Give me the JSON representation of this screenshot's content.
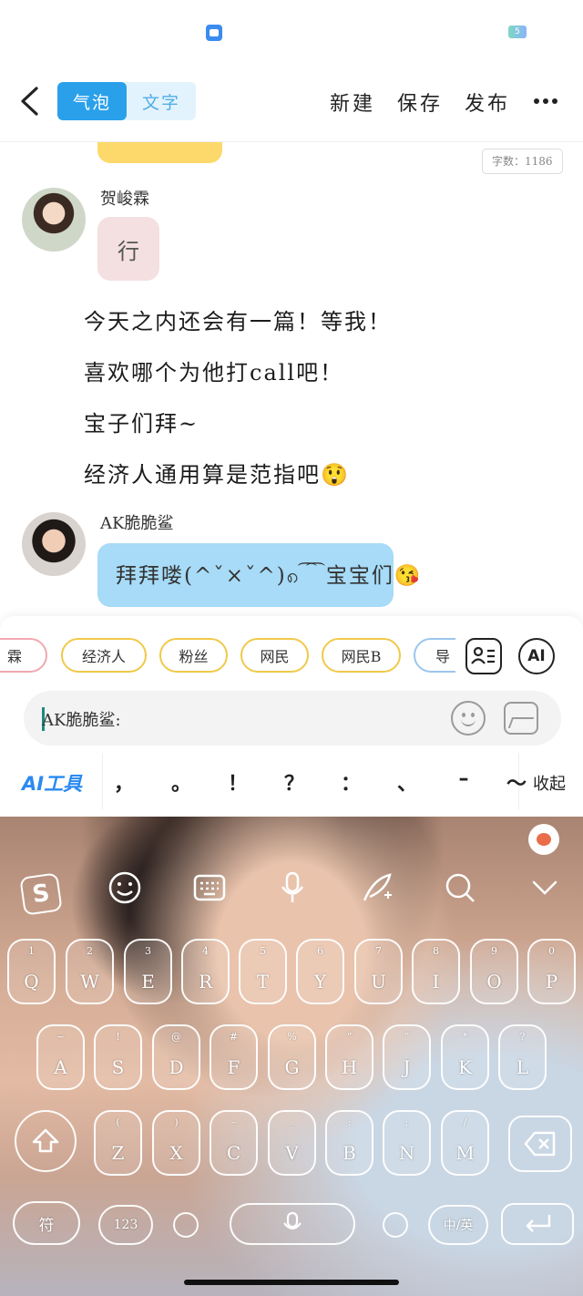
{
  "status": {
    "battery_label": "5"
  },
  "header": {
    "mode_tabs": [
      "气泡",
      "文字"
    ],
    "actions": {
      "new": "新建",
      "save": "保存",
      "publish": "发布"
    }
  },
  "chat": {
    "char_count": "字数：1186",
    "messages": [
      {
        "sender": "贺峻霖",
        "text": "行"
      },
      {
        "narration": [
          "今天之内还会有一篇！等我！",
          "喜欢哪个为他打call吧！",
          "宝子们拜~",
          "经济人通用算是范指吧😲"
        ]
      },
      {
        "sender": "AK脆脆鲨",
        "text": "拜拜喽(^ˇ×ˇ^)၈ ͡ ͡ 宝宝们😘"
      }
    ]
  },
  "composer": {
    "role_chips": [
      "霖",
      "经济人",
      "粉丝",
      "网民",
      "网民B",
      "导"
    ],
    "ai_label": "AI",
    "input_value": "AK脆脆鲨:",
    "ai_tool_label": "AI工具",
    "punctuation": [
      "，",
      "。",
      "！",
      "？",
      "：",
      "、",
      "–",
      "～"
    ],
    "collapse_label": "收起"
  },
  "keyboard": {
    "logo": "S",
    "row1": [
      {
        "main": "Q",
        "sub": "1"
      },
      {
        "main": "W",
        "sub": "2"
      },
      {
        "main": "E",
        "sub": "3"
      },
      {
        "main": "R",
        "sub": "4"
      },
      {
        "main": "T",
        "sub": "5"
      },
      {
        "main": "Y",
        "sub": "6"
      },
      {
        "main": "U",
        "sub": "7"
      },
      {
        "main": "I",
        "sub": "8"
      },
      {
        "main": "O",
        "sub": "9"
      },
      {
        "main": "P",
        "sub": "0"
      }
    ],
    "row2": [
      {
        "main": "A",
        "sub": "~"
      },
      {
        "main": "S",
        "sub": "!"
      },
      {
        "main": "D",
        "sub": "@"
      },
      {
        "main": "F",
        "sub": "#"
      },
      {
        "main": "G",
        "sub": "%"
      },
      {
        "main": "H",
        "sub": "“"
      },
      {
        "main": "J",
        "sub": "”"
      },
      {
        "main": "K",
        "sub": "*"
      },
      {
        "main": "L",
        "sub": "?"
      }
    ],
    "row3": [
      {
        "main": "Z",
        "sub": "("
      },
      {
        "main": "X",
        "sub": ")"
      },
      {
        "main": "C",
        "sub": "–"
      },
      {
        "main": "V",
        "sub": "_"
      },
      {
        "main": "B",
        "sub": ":"
      },
      {
        "main": "N",
        "sub": ";"
      },
      {
        "main": "M",
        "sub": "/"
      }
    ],
    "symbol_key": "符",
    "num_key": "123",
    "lang_key": "中/英"
  }
}
